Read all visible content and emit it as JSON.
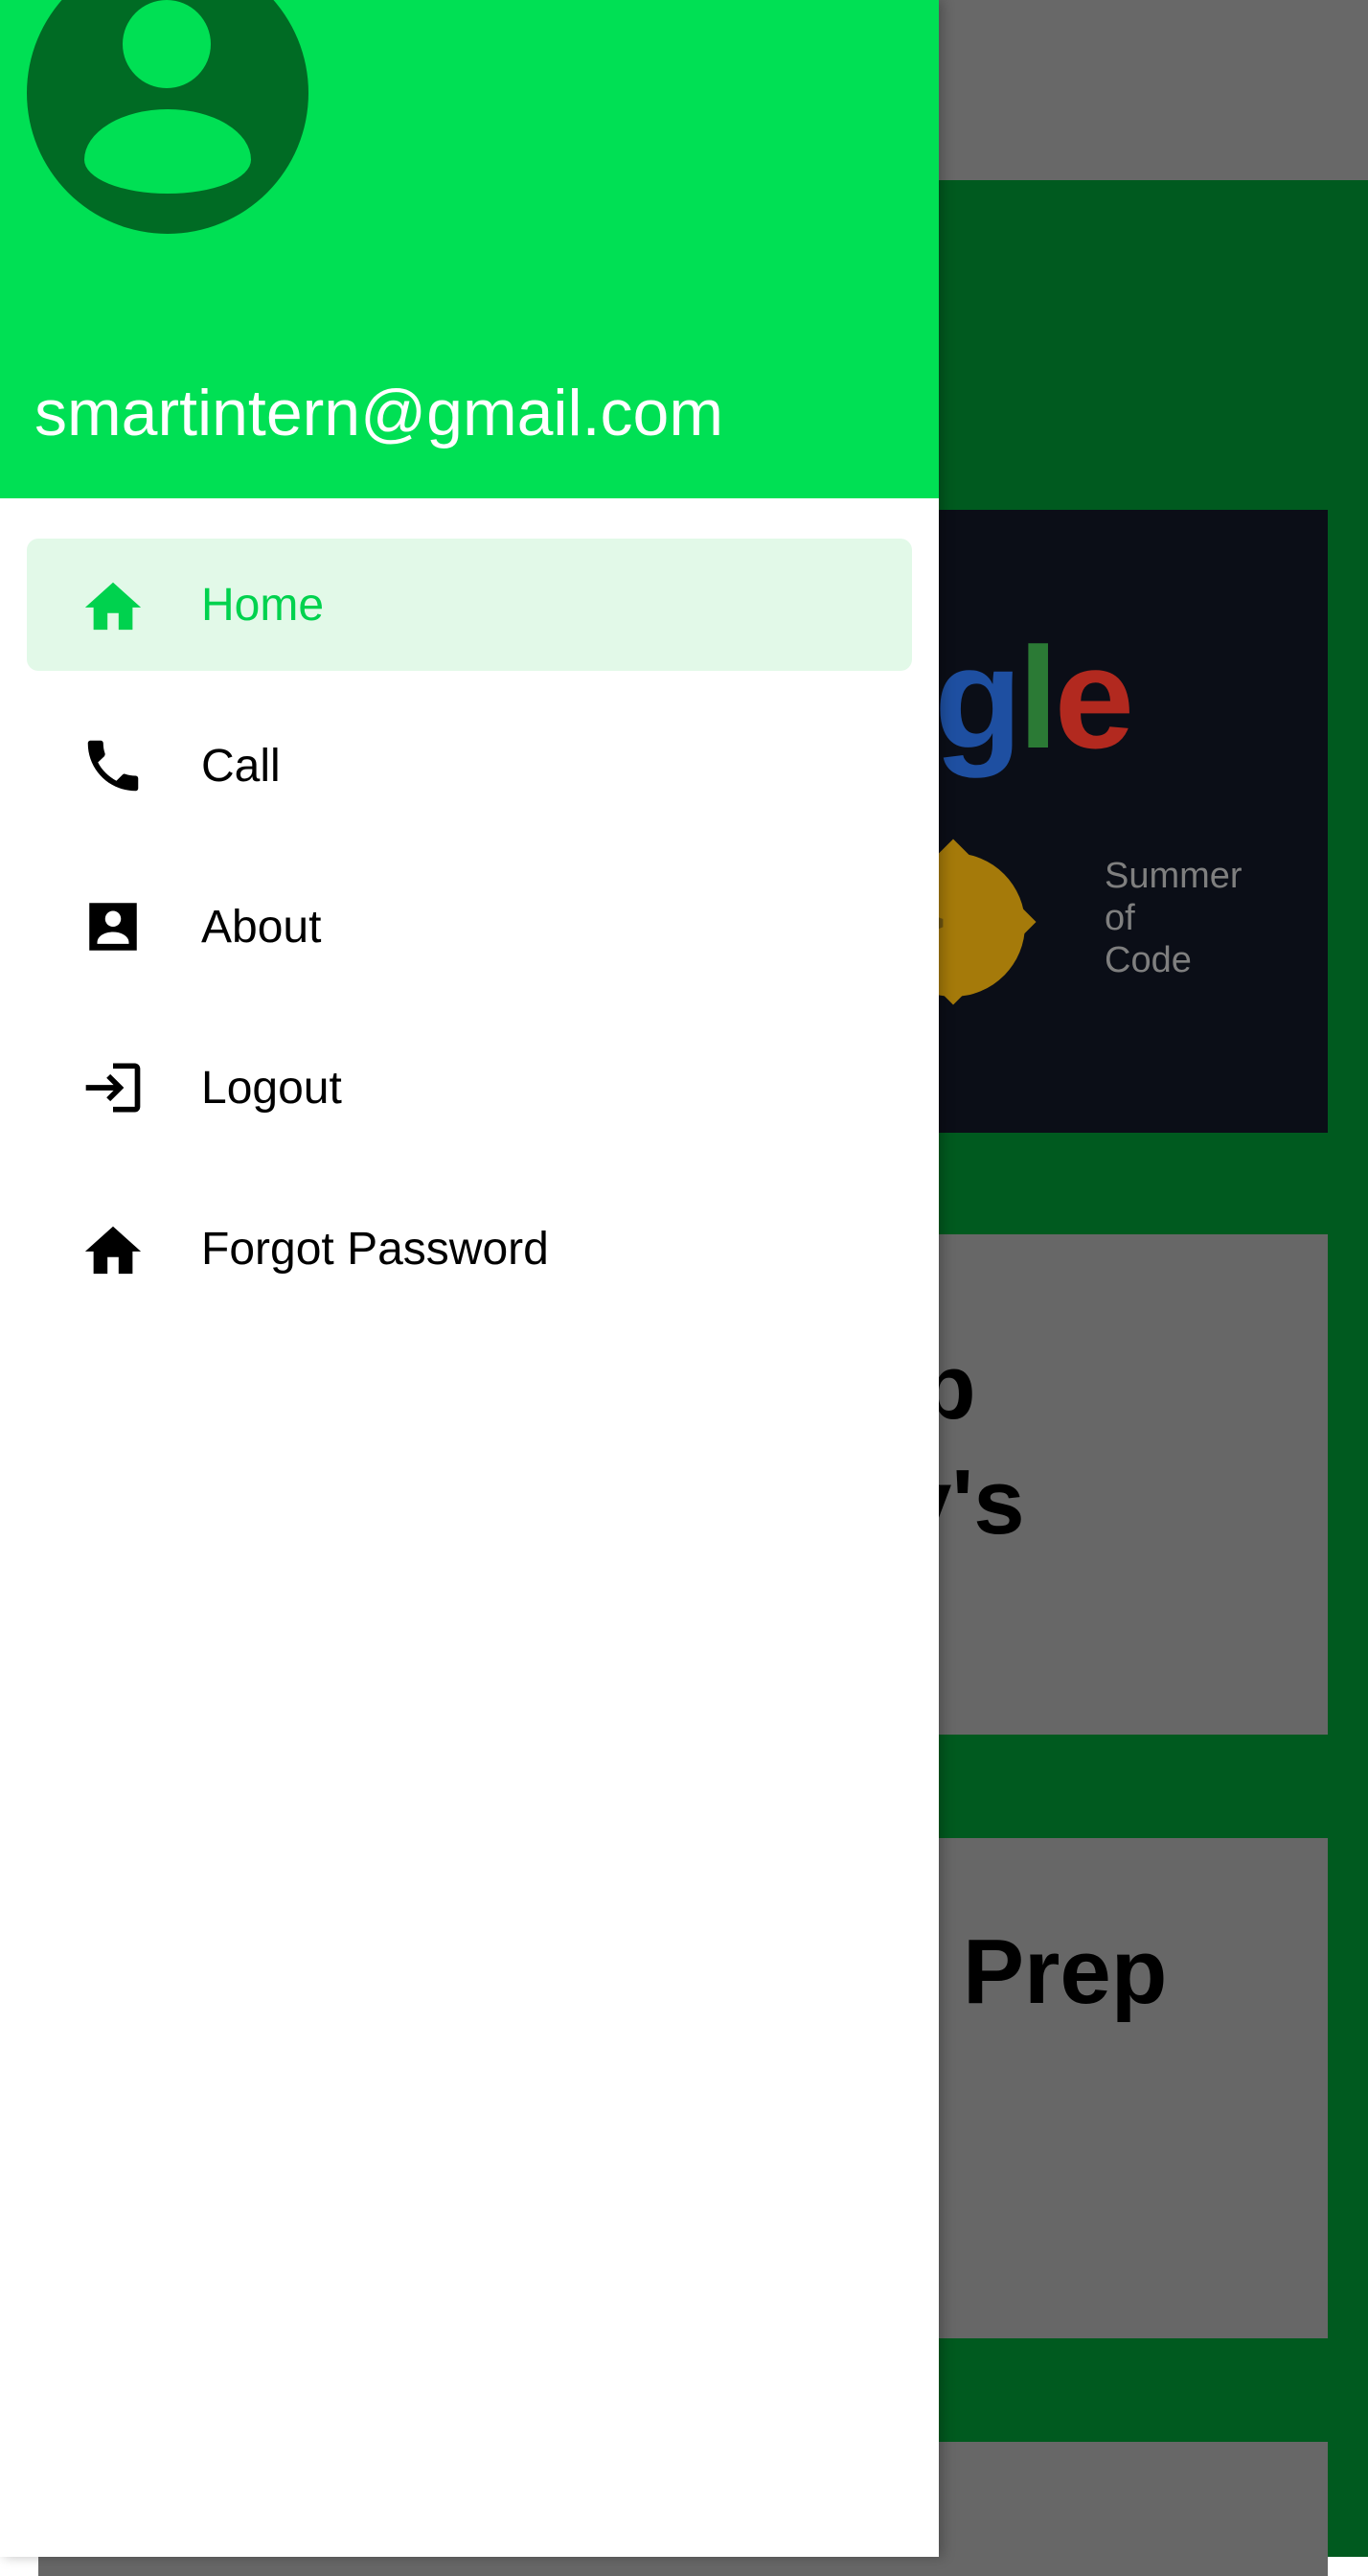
{
  "colors": {
    "drawer_header": "#00e054",
    "avatar_bg": "#006b24",
    "active_item_bg": "#e2f9e8",
    "active_item_text": "#00d24e",
    "background_app": "#005a1f"
  },
  "drawer": {
    "email": "smartintern@gmail.com",
    "items": [
      {
        "label": "Home",
        "icon": "home-icon",
        "active": true
      },
      {
        "label": "Call",
        "icon": "phone-icon",
        "active": false
      },
      {
        "label": "About",
        "icon": "contact-card-icon",
        "active": false
      },
      {
        "label": "Logout",
        "icon": "login-arrow-icon",
        "active": false
      },
      {
        "label": "Forgot Password",
        "icon": "home-icon",
        "active": false
      }
    ]
  },
  "background": {
    "gsoc_word": "oogle",
    "gsoc_text_lines": [
      "Summer",
      "of",
      "Code"
    ],
    "card2_text_lines": [
      "p",
      "y's"
    ],
    "card3_text": "Prep"
  }
}
